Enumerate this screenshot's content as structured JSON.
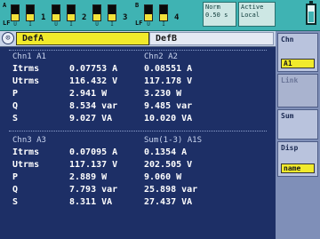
{
  "topbar": {
    "groups": [
      {
        "tag_top": "A",
        "tag_bottom": "LF",
        "number": "1",
        "channels": [
          "U",
          "I"
        ]
      },
      {
        "tag_top": "",
        "tag_bottom": "",
        "number": "2",
        "channels": [
          "U",
          "I"
        ]
      },
      {
        "tag_top": "",
        "tag_bottom": "",
        "number": "3",
        "channels": [
          "U",
          "I"
        ]
      },
      {
        "tag_top": "B",
        "tag_bottom": "LF",
        "number": "4",
        "channels": [
          "U",
          "I"
        ]
      }
    ],
    "status": {
      "line1a": "Norm",
      "line1b": "Active",
      "line2a": "0.50 s",
      "line2b": "Local"
    }
  },
  "tabs": {
    "active": "DefA",
    "inactive": "DefB"
  },
  "section1": {
    "left_header": "Chn1 A1",
    "right_header": "Chn2 A2",
    "rows": [
      {
        "name": "Itrms",
        "v1": "0.07753 A",
        "v2": "0.08551 A"
      },
      {
        "name": "Utrms",
        "v1": "116.432 V",
        "v2": "117.178 V"
      },
      {
        "name": "P",
        "v1": "2.941 W",
        "v2": "3.230 W"
      },
      {
        "name": "Q",
        "v1": "8.534 var",
        "v2": "9.485 var"
      },
      {
        "name": "S",
        "v1": "9.027 VA",
        "v2": "10.020 VA"
      }
    ]
  },
  "section2": {
    "left_header": "Chn3 A3",
    "right_header": "Sum(1-3) A1S",
    "rows": [
      {
        "name": "Itrms",
        "v1": "0.07095 A",
        "v2": "0.1354 A"
      },
      {
        "name": "Utrms",
        "v1": "117.137 V",
        "v2": "202.505 V"
      },
      {
        "name": "P",
        "v1": "2.889 W",
        "v2": "9.060 W"
      },
      {
        "name": "Q",
        "v1": "7.793 var",
        "v2": "25.898 var"
      },
      {
        "name": "S",
        "v1": "8.311 VA",
        "v2": "27.437 VA"
      }
    ]
  },
  "side": {
    "chn_label": "Chn",
    "chn_value": "A1",
    "link_label": "Link",
    "sum_label": "Sum",
    "disp_label": "Disp",
    "disp_value": "name"
  }
}
